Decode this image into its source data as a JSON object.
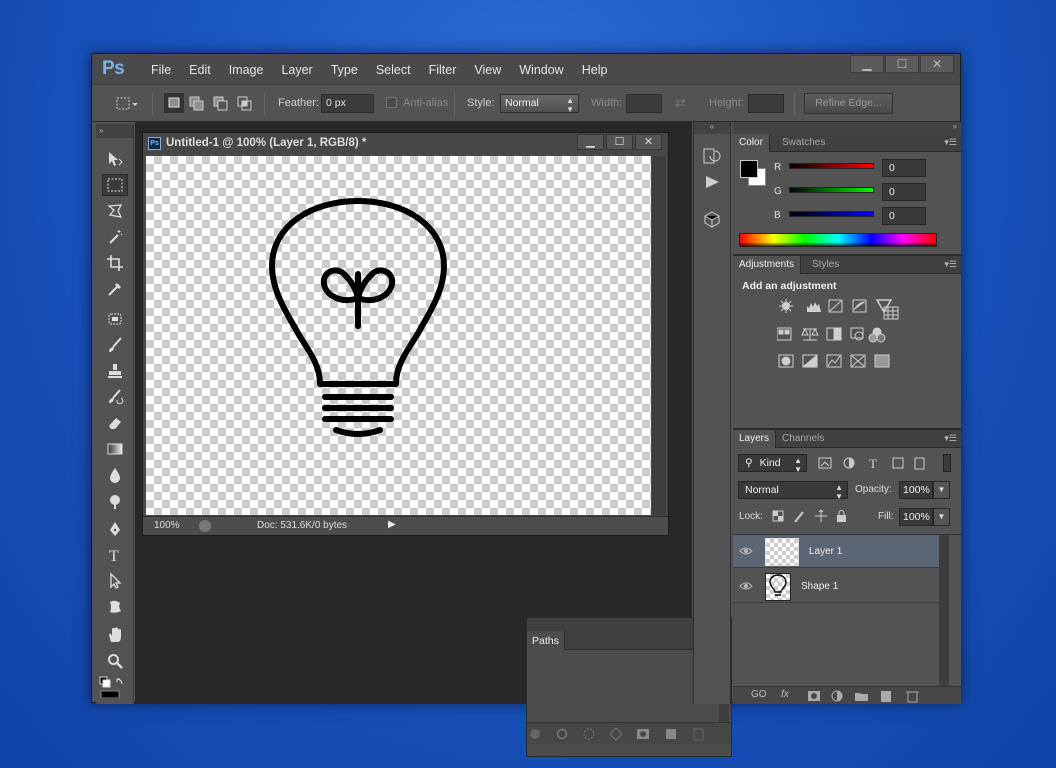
{
  "app": {
    "logo": "Ps",
    "menu": [
      "File",
      "Edit",
      "Image",
      "Layer",
      "Type",
      "Select",
      "Filter",
      "View",
      "Window",
      "Help"
    ],
    "window_controls": {
      "minimize": "▁",
      "maximize": "☐",
      "close": "✕"
    }
  },
  "options_bar": {
    "feather_label": "Feather:",
    "feather_value": "0 px",
    "antialias_label": "Anti-alias",
    "style_label": "Style:",
    "style_value": "Normal",
    "width_label": "Width:",
    "height_label": "Height:",
    "refine_edge_label": "Refine Edge..."
  },
  "document": {
    "icon_label": "Ps",
    "title": "Untitled-1 @ 100% (Layer 1, RGB/8) *",
    "zoom": "100%",
    "doc_info": "Doc: 531.6K/0 bytes",
    "controls": {
      "minimize": "▁",
      "maximize": "☐",
      "close": "✕"
    }
  },
  "color_panel": {
    "tabs": [
      "Color",
      "Swatches"
    ],
    "channels": [
      {
        "label": "R",
        "value": "0"
      },
      {
        "label": "G",
        "value": "0"
      },
      {
        "label": "B",
        "value": "0"
      }
    ],
    "foreground": "#000000",
    "background": "#ffffff"
  },
  "adjustments_panel": {
    "tabs": [
      "Adjustments",
      "Styles"
    ],
    "heading": "Add an adjustment"
  },
  "layers_panel": {
    "tabs": [
      "Layers",
      "Channels"
    ],
    "kind_label": "Kind",
    "blend_mode": "Normal",
    "opacity_label": "Opacity:",
    "opacity_value": "100%",
    "lock_label": "Lock:",
    "fill_label": "Fill:",
    "fill_value": "100%",
    "layers": [
      {
        "name": "Layer 1",
        "selected": true
      },
      {
        "name": "Shape 1",
        "selected": false
      }
    ],
    "footer": [
      "GO",
      "fx"
    ]
  },
  "paths_panel": {
    "tab": "Paths"
  },
  "colors": {
    "accent": "#7fb1e6",
    "desktop": "#1a56c0",
    "panel_bg": "#535353",
    "workspace_bg": "#282828",
    "selected_layer": "#5b6675"
  }
}
